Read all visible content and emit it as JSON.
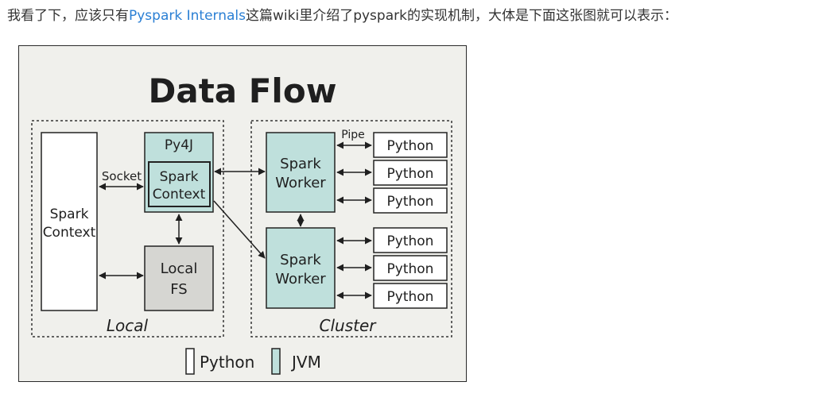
{
  "intro": {
    "before": "我看了下，应该只有",
    "link": "Pyspark Internals",
    "after": "这篇wiki里介绍了pyspark的实现机制，大体是下面这张图就可以表示："
  },
  "diagram": {
    "title": "Data Flow",
    "local_label": "Local",
    "cluster_label": "Cluster",
    "driver_spark_context": [
      "Spark",
      "Context"
    ],
    "socket_label": "Socket",
    "py4j_label": "Py4J",
    "jvm_spark_context": [
      "Spark",
      "Context"
    ],
    "local_fs": [
      "Local",
      "FS"
    ],
    "pipe_label": "Pipe",
    "worker": [
      "Spark",
      "Worker"
    ],
    "python_label": "Python",
    "legend_python": "Python",
    "legend_jvm": "JVM"
  },
  "colors": {
    "jvm_fill": "#bfe0dc",
    "python_fill": "#ffffff",
    "fs_fill": "#d6d6d2",
    "background": "#f0f0ec",
    "link": "#2a7fd4"
  }
}
